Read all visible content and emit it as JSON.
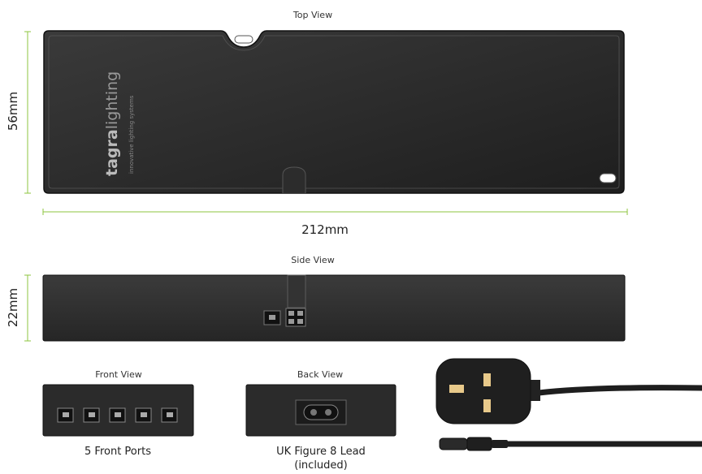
{
  "top_view": {
    "caption": "Top View",
    "height_label": "56mm",
    "width_label": "212mm",
    "brand_bold": "tagra",
    "brand_light": "lighting",
    "brand_tagline": "innovative lighting systems"
  },
  "side_view": {
    "caption": "Side View",
    "height_label": "22mm"
  },
  "front_view": {
    "caption": "Front View",
    "label": "5 Front Ports",
    "port_count": 5
  },
  "back_view": {
    "caption": "Back View",
    "label_line1": "UK Figure 8 Lead",
    "label_line2": "(included)"
  },
  "colors": {
    "dimension_line": "#8dc63f",
    "device_body": "#2a2a2a",
    "plug_pin": "#e8c98a"
  }
}
